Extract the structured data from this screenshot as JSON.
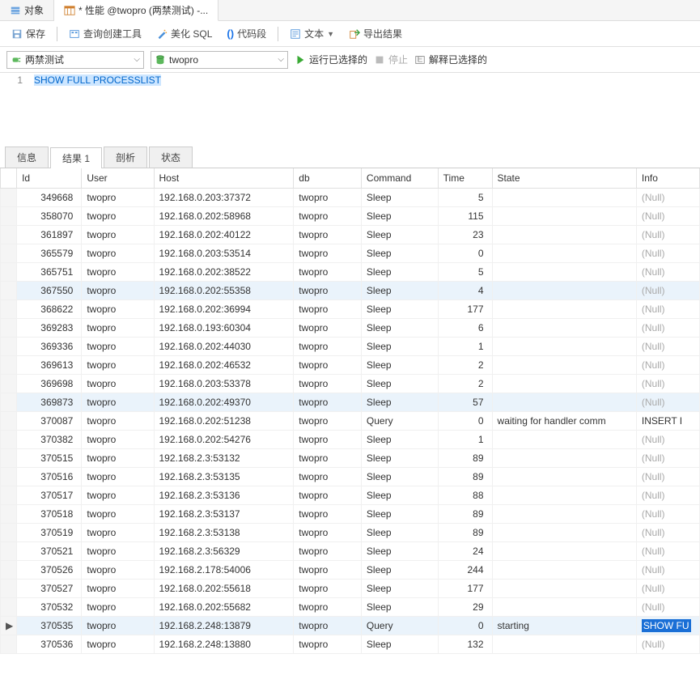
{
  "tabs": {
    "objects": "对象",
    "query": "* 性能 @twopro (两禁测试) -..."
  },
  "toolbar": {
    "save": "保存",
    "query_builder": "查询创建工具",
    "beautify": "美化 SQL",
    "snippet": "代码段",
    "text": "文本",
    "export": "导出结果"
  },
  "toolbar2": {
    "conn": "两禁测试",
    "db": "twopro",
    "run": "运行已选择的",
    "stop": "停止",
    "explain": "解释已选择的"
  },
  "editor": {
    "line": "1",
    "sql": "SHOW FULL PROCESSLIST"
  },
  "result_tabs": {
    "info": "信息",
    "result": "结果 1",
    "profile": "剖析",
    "status": "状态"
  },
  "columns": [
    "Id",
    "User",
    "Host",
    "db",
    "Command",
    "Time",
    "State",
    "Info"
  ],
  "null_label": "(Null)",
  "rows": [
    {
      "id": "349668",
      "user": "twopro",
      "host": "192.168.0.203:37372",
      "db": "twopro",
      "cmd": "Sleep",
      "time": "5",
      "state": "",
      "info": null
    },
    {
      "id": "358070",
      "user": "twopro",
      "host": "192.168.0.202:58968",
      "db": "twopro",
      "cmd": "Sleep",
      "time": "115",
      "state": "",
      "info": null
    },
    {
      "id": "361897",
      "user": "twopro",
      "host": "192.168.0.202:40122",
      "db": "twopro",
      "cmd": "Sleep",
      "time": "23",
      "state": "",
      "info": null
    },
    {
      "id": "365579",
      "user": "twopro",
      "host": "192.168.0.203:53514",
      "db": "twopro",
      "cmd": "Sleep",
      "time": "0",
      "state": "",
      "info": null
    },
    {
      "id": "365751",
      "user": "twopro",
      "host": "192.168.0.202:38522",
      "db": "twopro",
      "cmd": "Sleep",
      "time": "5",
      "state": "",
      "info": null
    },
    {
      "id": "367550",
      "user": "twopro",
      "host": "192.168.0.202:55358",
      "db": "twopro",
      "cmd": "Sleep",
      "time": "4",
      "state": "",
      "info": null,
      "hl": true
    },
    {
      "id": "368622",
      "user": "twopro",
      "host": "192.168.0.202:36994",
      "db": "twopro",
      "cmd": "Sleep",
      "time": "177",
      "state": "",
      "info": null
    },
    {
      "id": "369283",
      "user": "twopro",
      "host": "192.168.0.193:60304",
      "db": "twopro",
      "cmd": "Sleep",
      "time": "6",
      "state": "",
      "info": null
    },
    {
      "id": "369336",
      "user": "twopro",
      "host": "192.168.0.202:44030",
      "db": "twopro",
      "cmd": "Sleep",
      "time": "1",
      "state": "",
      "info": null
    },
    {
      "id": "369613",
      "user": "twopro",
      "host": "192.168.0.202:46532",
      "db": "twopro",
      "cmd": "Sleep",
      "time": "2",
      "state": "",
      "info": null
    },
    {
      "id": "369698",
      "user": "twopro",
      "host": "192.168.0.203:53378",
      "db": "twopro",
      "cmd": "Sleep",
      "time": "2",
      "state": "",
      "info": null
    },
    {
      "id": "369873",
      "user": "twopro",
      "host": "192.168.0.202:49370",
      "db": "twopro",
      "cmd": "Sleep",
      "time": "57",
      "state": "",
      "info": null,
      "hl": true
    },
    {
      "id": "370087",
      "user": "twopro",
      "host": "192.168.0.202:51238",
      "db": "twopro",
      "cmd": "Query",
      "time": "0",
      "state": "waiting for handler comm",
      "info": "INSERT I"
    },
    {
      "id": "370382",
      "user": "twopro",
      "host": "192.168.0.202:54276",
      "db": "twopro",
      "cmd": "Sleep",
      "time": "1",
      "state": "",
      "info": null
    },
    {
      "id": "370515",
      "user": "twopro",
      "host": "192.168.2.3:53132",
      "db": "twopro",
      "cmd": "Sleep",
      "time": "89",
      "state": "",
      "info": null
    },
    {
      "id": "370516",
      "user": "twopro",
      "host": "192.168.2.3:53135",
      "db": "twopro",
      "cmd": "Sleep",
      "time": "89",
      "state": "",
      "info": null
    },
    {
      "id": "370517",
      "user": "twopro",
      "host": "192.168.2.3:53136",
      "db": "twopro",
      "cmd": "Sleep",
      "time": "88",
      "state": "",
      "info": null
    },
    {
      "id": "370518",
      "user": "twopro",
      "host": "192.168.2.3:53137",
      "db": "twopro",
      "cmd": "Sleep",
      "time": "89",
      "state": "",
      "info": null
    },
    {
      "id": "370519",
      "user": "twopro",
      "host": "192.168.2.3:53138",
      "db": "twopro",
      "cmd": "Sleep",
      "time": "89",
      "state": "",
      "info": null
    },
    {
      "id": "370521",
      "user": "twopro",
      "host": "192.168.2.3:56329",
      "db": "twopro",
      "cmd": "Sleep",
      "time": "24",
      "state": "",
      "info": null
    },
    {
      "id": "370526",
      "user": "twopro",
      "host": "192.168.2.178:54006",
      "db": "twopro",
      "cmd": "Sleep",
      "time": "244",
      "state": "",
      "info": null
    },
    {
      "id": "370527",
      "user": "twopro",
      "host": "192.168.0.202:55618",
      "db": "twopro",
      "cmd": "Sleep",
      "time": "177",
      "state": "",
      "info": null
    },
    {
      "id": "370532",
      "user": "twopro",
      "host": "192.168.0.202:55682",
      "db": "twopro",
      "cmd": "Sleep",
      "time": "29",
      "state": "",
      "info": null
    },
    {
      "id": "370535",
      "user": "twopro",
      "host": "192.168.2.248:13879",
      "db": "twopro",
      "cmd": "Query",
      "time": "0",
      "state": "starting",
      "info": "SHOW FU",
      "hl": true,
      "active": true
    },
    {
      "id": "370536",
      "user": "twopro",
      "host": "192.168.2.248:13880",
      "db": "twopro",
      "cmd": "Sleep",
      "time": "132",
      "state": "",
      "info": null
    }
  ]
}
